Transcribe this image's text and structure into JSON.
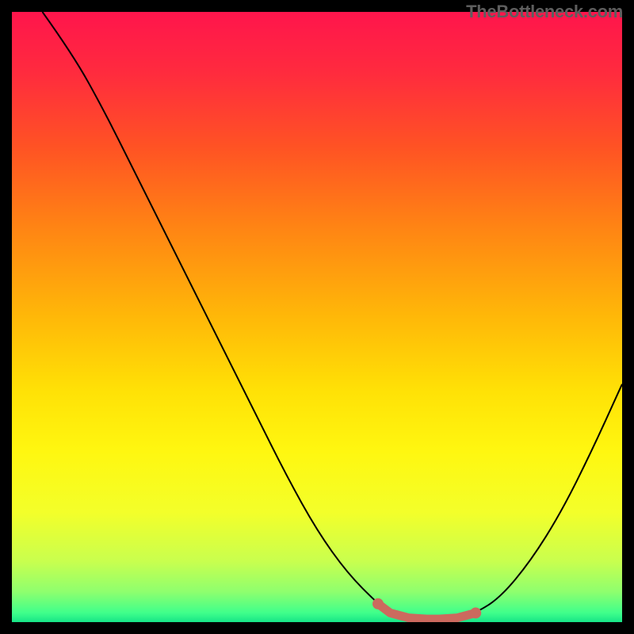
{
  "watermark": "TheBottleneck.com",
  "chart_data": {
    "type": "line",
    "title": "",
    "xlabel": "",
    "ylabel": "",
    "xlim": [
      0,
      100
    ],
    "ylim": [
      0,
      100
    ],
    "series": [
      {
        "name": "curve",
        "x": [
          5,
          10,
          15,
          20,
          25,
          30,
          35,
          40,
          45,
          50,
          55,
          60,
          62,
          65,
          68,
          70,
          73,
          76,
          80,
          85,
          90,
          95,
          100
        ],
        "y": [
          100,
          93,
          84,
          74,
          64,
          54,
          44,
          34,
          24,
          15,
          8,
          3,
          1.5,
          0.7,
          0.5,
          0.5,
          0.7,
          1.5,
          4,
          10,
          18,
          28,
          39
        ]
      },
      {
        "name": "highlight",
        "x": [
          60,
          62,
          65,
          68,
          70,
          73,
          76
        ],
        "y": [
          3,
          1.5,
          0.7,
          0.5,
          0.5,
          0.7,
          1.5
        ]
      }
    ],
    "gradient_stops": [
      {
        "offset": 0.0,
        "color": "#ff154c"
      },
      {
        "offset": 0.1,
        "color": "#ff2b3e"
      },
      {
        "offset": 0.22,
        "color": "#ff5224"
      },
      {
        "offset": 0.35,
        "color": "#ff8314"
      },
      {
        "offset": 0.5,
        "color": "#ffb808"
      },
      {
        "offset": 0.62,
        "color": "#ffe106"
      },
      {
        "offset": 0.72,
        "color": "#fff710"
      },
      {
        "offset": 0.82,
        "color": "#f3ff2a"
      },
      {
        "offset": 0.9,
        "color": "#c9ff4e"
      },
      {
        "offset": 0.95,
        "color": "#8fff6e"
      },
      {
        "offset": 0.985,
        "color": "#3fff8b"
      },
      {
        "offset": 1.0,
        "color": "#17e487"
      }
    ]
  }
}
